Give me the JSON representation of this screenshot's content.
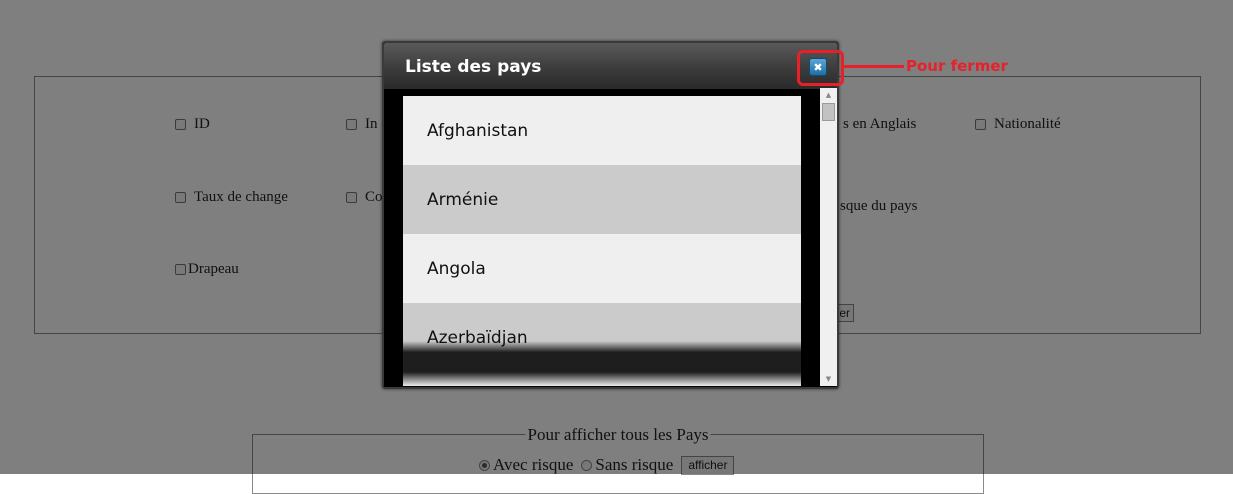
{
  "background_form": {
    "checkboxes": [
      {
        "label": "ID"
      },
      {
        "label": "In"
      },
      {
        "label": "s en Anglais"
      },
      {
        "label": "Nationalité"
      },
      {
        "label": "Taux de change"
      },
      {
        "label": "Co"
      },
      {
        "label": "sque du pays"
      },
      {
        "label": "Drapeau"
      }
    ],
    "submit_partial_label": "er"
  },
  "show_all": {
    "legend": "Pour afficher tous les Pays",
    "options": [
      {
        "label": "Avec risque",
        "checked": true
      },
      {
        "label": "Sans risque",
        "checked": false
      }
    ],
    "button_label": "afficher"
  },
  "dialog": {
    "title": "Liste des pays",
    "close_icon": "close-x-icon",
    "countries": [
      "Afghanistan",
      "Arménie",
      "Angola",
      "Azerbaïdjan"
    ]
  },
  "annotation": {
    "label": "Pour fermer",
    "color": "#e8202a"
  }
}
